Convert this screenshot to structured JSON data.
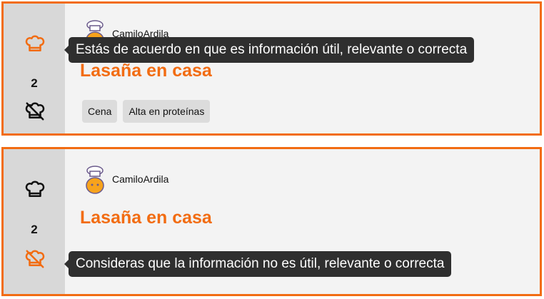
{
  "colors": {
    "accent": "#f26c12",
    "tooltip_bg": "#2f2f2f",
    "vote_col_bg": "#d8d8d8",
    "card_bg": "#f3f3f3"
  },
  "cards": [
    {
      "state": "upvote-hover",
      "author": "CamiloArdila",
      "title": "Lasaña en casa",
      "votes": "2",
      "upvote_icon": "chef-hat-icon",
      "downvote_icon": "chef-hat-off-icon",
      "tags": [
        "Cena",
        "Alta en proteínas"
      ],
      "tooltip": "Estás de acuerdo en que es información útil, relevante o correcta"
    },
    {
      "state": "downvote-hover",
      "author": "CamiloArdila",
      "title": "Lasaña en casa",
      "votes": "2",
      "upvote_icon": "chef-hat-icon",
      "downvote_icon": "chef-hat-off-icon",
      "tooltip": "Consideras que la información no es útil, relevante o correcta"
    }
  ]
}
